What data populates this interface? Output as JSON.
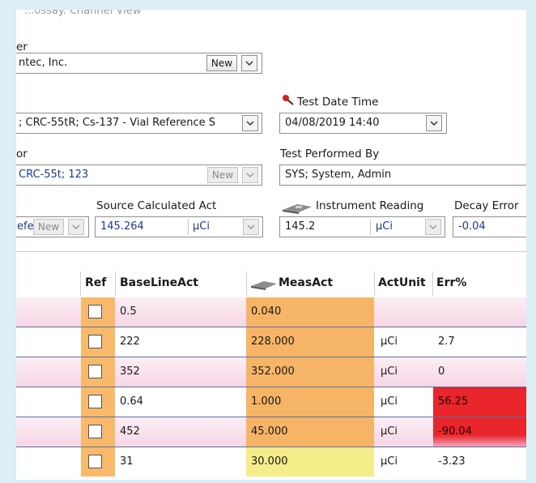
{
  "header_cut": "...ossay. Channel View",
  "manufacturer": {
    "label": "er",
    "value": "ntec, Inc.",
    "new_label": "New"
  },
  "source": {
    "value": "; CRC-55tR; Cs-137 - Vial Reference S"
  },
  "test_date": {
    "label": "Test Date Time",
    "value": "04/08/2019 14:40"
  },
  "instrument": {
    "label": "or",
    "value": "CRC-55t; 123",
    "new_label": "New"
  },
  "performed_by": {
    "label": "Test Performed By",
    "value": "SYS; System, Admin"
  },
  "ref_field": {
    "value": "efe",
    "new_label": "New"
  },
  "calc_act": {
    "label": "Source Calculated Act",
    "value": "145.264",
    "unit": "µCi"
  },
  "inst_reading": {
    "label": "Instrument Reading",
    "value": "145.2",
    "unit": "µCi"
  },
  "decay_error": {
    "label": "Decay Error",
    "value": "-0.04"
  },
  "table": {
    "headers": {
      "ref": "Ref",
      "baseline": "BaseLineAct",
      "meas": "MeasAct",
      "unit": "ActUnit",
      "err": "Err%"
    },
    "rows": [
      {
        "baseline": "0.5",
        "meas": "0.040",
        "unit": "",
        "err": ""
      },
      {
        "baseline": "222",
        "meas": "228.000",
        "unit": "µCi",
        "err": "2.7"
      },
      {
        "baseline": "352",
        "meas": "352.000",
        "unit": "µCi",
        "err": "0"
      },
      {
        "baseline": "0.64",
        "meas": "1.000",
        "unit": "µCi",
        "err": "56.25"
      },
      {
        "baseline": "452",
        "meas": "45.000",
        "unit": "µCi",
        "err": "-90.04"
      },
      {
        "baseline": "31",
        "meas": "30.000",
        "unit": "µCi",
        "err": "-3.23"
      }
    ]
  },
  "colors": {
    "ref_col": "#f9b96a",
    "meas_col": "#f6b466",
    "meas_yellow": "#f5ec8a",
    "err_red": "#e8262b",
    "pink_row": "#f7dbe8"
  }
}
